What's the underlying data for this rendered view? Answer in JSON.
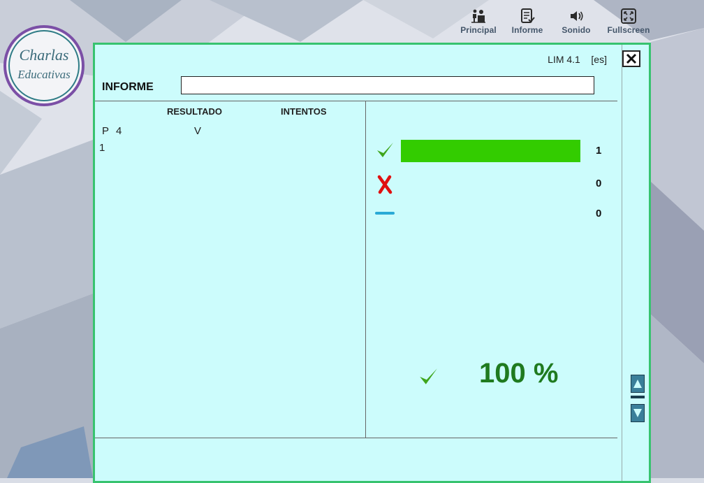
{
  "toolbar": {
    "items": [
      {
        "label": "Principal",
        "icon": "home-people-icon"
      },
      {
        "label": "Informe",
        "icon": "report-icon"
      },
      {
        "label": "Sonido",
        "icon": "speaker-icon"
      },
      {
        "label": "Fullscreen",
        "icon": "fullscreen-icon"
      }
    ]
  },
  "logo": {
    "line1": "Charlas",
    "line2": "Educativas"
  },
  "panel": {
    "version": "LIM 4.1",
    "lang": "[es]",
    "informe_label": "INFORME",
    "informe_value": "",
    "columns": {
      "resultado": "RESULTADO",
      "intentos": "INTENTOS"
    },
    "rows": [
      {
        "prefix": "P",
        "number": "4",
        "result": "V",
        "index": "1"
      }
    ],
    "stats": [
      {
        "kind": "correct",
        "icon": "check-icon",
        "count": "1",
        "fraction": 1.0,
        "color": "#33cc00"
      },
      {
        "kind": "wrong",
        "icon": "cross-icon",
        "count": "0",
        "fraction": 0,
        "color": "#e01010"
      },
      {
        "kind": "skipped",
        "icon": "dash-icon",
        "count": "0",
        "fraction": 0,
        "color": "#2aaad6"
      }
    ],
    "percentage": "100 %"
  },
  "colors": {
    "panel_bg": "#ccfcfc",
    "panel_border": "#37c36f",
    "check": "#3fa51c",
    "cross": "#e01010",
    "dash": "#2aaad6",
    "percentage": "#1f7a1f"
  }
}
